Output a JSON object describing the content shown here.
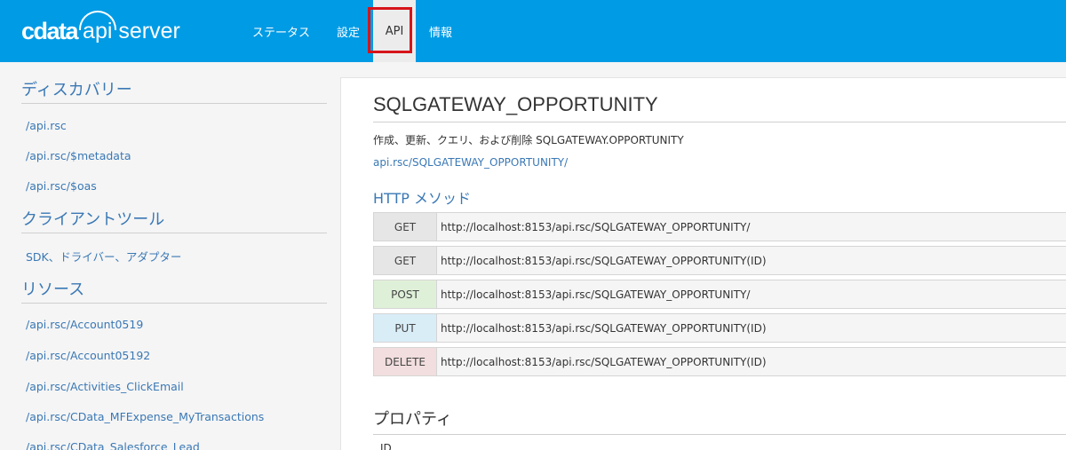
{
  "header": {
    "logo_brand": "cdata",
    "logo_product": "api server",
    "nav": [
      "ステータス",
      "設定",
      "API",
      "情報"
    ],
    "active_nav": "API"
  },
  "sidebar": {
    "discovery_title": "ディスカバリー",
    "discovery_links": [
      "/api.rsc",
      "/api.rsc/$metadata",
      "/api.rsc/$oas"
    ],
    "client_title": "クライアントツール",
    "client_links": [
      "SDK、ドライバー、アダプター"
    ],
    "resources_title": "リソース",
    "resource_links": [
      "/api.rsc/Account0519",
      "/api.rsc/Account05192",
      "/api.rsc/Activities_ClickEmail",
      "/api.rsc/CData_MFExpense_MyTransactions",
      "/api.rsc/CData_Salesforce_Lead"
    ]
  },
  "main": {
    "title": "SQLGATEWAY_OPPORTUNITY",
    "description": "作成、更新、クエリ、および削除 SQLGATEWAY.OPPORTUNITY",
    "link": "api.rsc/SQLGATEWAY_OPPORTUNITY/",
    "http_title": "HTTP メソッド",
    "methods": [
      {
        "method": "GET",
        "url": "http://localhost:8153/api.rsc/SQLGATEWAY_OPPORTUNITY/"
      },
      {
        "method": "GET",
        "url": "http://localhost:8153/api.rsc/SQLGATEWAY_OPPORTUNITY(ID)"
      },
      {
        "method": "POST",
        "url": "http://localhost:8153/api.rsc/SQLGATEWAY_OPPORTUNITY/"
      },
      {
        "method": "PUT",
        "url": "http://localhost:8153/api.rsc/SQLGATEWAY_OPPORTUNITY(ID)"
      },
      {
        "method": "DELETE",
        "url": "http://localhost:8153/api.rsc/SQLGATEWAY_OPPORTUNITY(ID)"
      }
    ],
    "props_title": "プロパティ",
    "props_first_col": "ID"
  },
  "colors": {
    "header_bg": "#009be5",
    "link": "#3a78b5",
    "highlight": "#d6141a",
    "get": "#e6e6e6",
    "post": "#dff0d8",
    "put": "#d9edf7",
    "delete": "#f2dede"
  }
}
